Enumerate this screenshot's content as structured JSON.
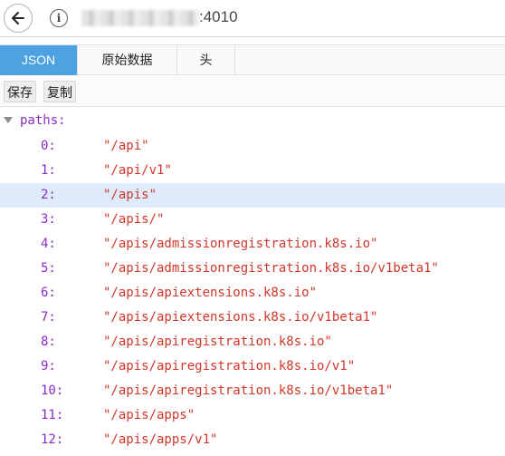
{
  "urlbar": {
    "url_visible": ":4010",
    "back_icon": "arrow-left-icon",
    "info_icon": "info-icon"
  },
  "tabs": [
    {
      "label": "JSON",
      "active": true
    },
    {
      "label": "原始数据",
      "active": false
    },
    {
      "label": "头",
      "active": false
    }
  ],
  "toolbar": {
    "save_label": "保存",
    "copy_label": "复制"
  },
  "tree": {
    "root_key": "paths:",
    "selected_index": 2,
    "items": [
      {
        "key": "0:",
        "value": "\"/api\""
      },
      {
        "key": "1:",
        "value": "\"/api/v1\""
      },
      {
        "key": "2:",
        "value": "\"/apis\""
      },
      {
        "key": "3:",
        "value": "\"/apis/\""
      },
      {
        "key": "4:",
        "value": "\"/apis/admissionregistration.k8s.io\""
      },
      {
        "key": "5:",
        "value": "\"/apis/admissionregistration.k8s.io/v1beta1\""
      },
      {
        "key": "6:",
        "value": "\"/apis/apiextensions.k8s.io\""
      },
      {
        "key": "7:",
        "value": "\"/apis/apiextensions.k8s.io/v1beta1\""
      },
      {
        "key": "8:",
        "value": "\"/apis/apiregistration.k8s.io\""
      },
      {
        "key": "9:",
        "value": "\"/apis/apiregistration.k8s.io/v1\""
      },
      {
        "key": "10:",
        "value": "\"/apis/apiregistration.k8s.io/v1beta1\""
      },
      {
        "key": "11:",
        "value": "\"/apis/apps\""
      },
      {
        "key": "12:",
        "value": "\"/apis/apps/v1\""
      }
    ]
  },
  "colors": {
    "key": "#8a2cc4",
    "string": "#d0372a",
    "active_tab": "#4da3e2",
    "selected_row": "#deebfa"
  }
}
